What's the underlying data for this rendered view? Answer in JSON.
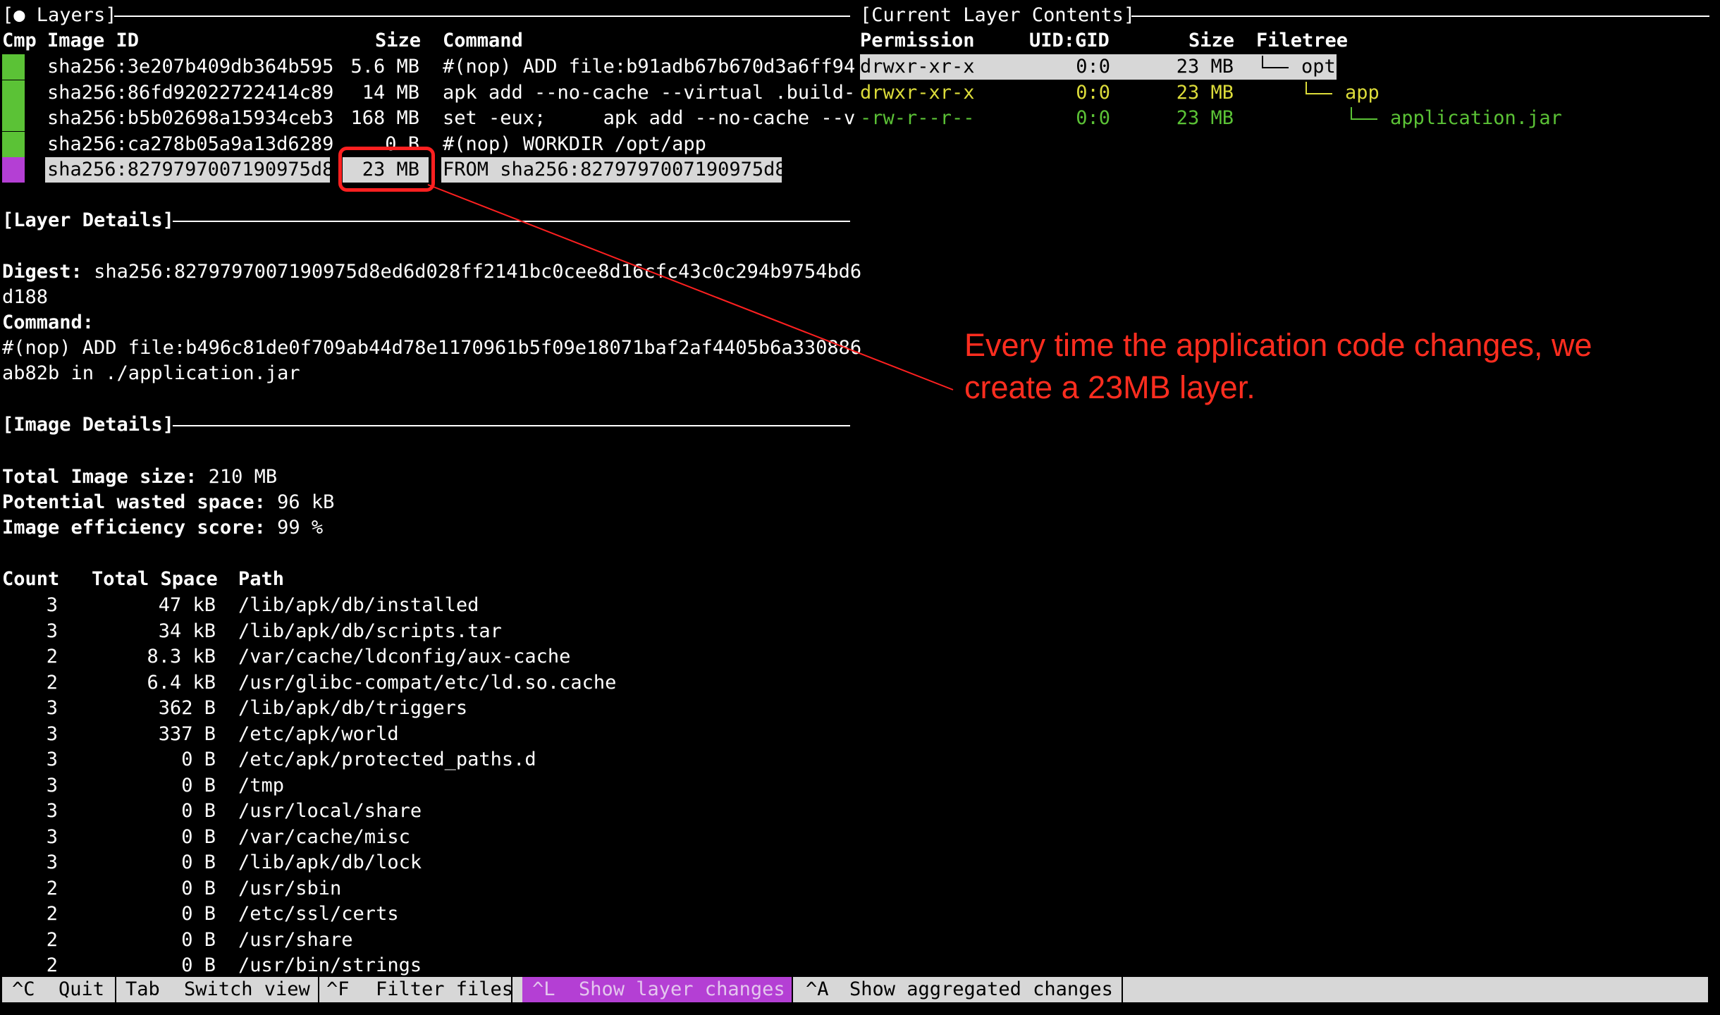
{
  "layers": {
    "title": "[● Layers]",
    "col_cmp": "Cmp",
    "col_image": "Image ID",
    "col_size": "Size",
    "col_command": "Command",
    "rows": [
      {
        "id": "sha256:3e207b409db364b595",
        "size": "5.6 MB",
        "command": "#(nop) ADD file:b91adb67b670d3a6ff94",
        "color": "#5bc236"
      },
      {
        "id": "sha256:86fd92022722414c89",
        "size": "14 MB",
        "command": "apk add --no-cache --virtual .build-",
        "color": "#5bc236"
      },
      {
        "id": "sha256:b5b02698a15934ceb3",
        "size": "168 MB",
        "command": "set -eux;     apk add --no-cache --v",
        "color": "#5bc236"
      },
      {
        "id": "sha256:ca278b05a9a13d6289",
        "size": "0 B",
        "command": "#(nop) WORKDIR /opt/app",
        "color": "#5bc236"
      },
      {
        "id": "sha256:8279797007190975d8",
        "size": "23 MB",
        "command": "FROM sha256:8279797007190975d8",
        "color": "#b43fd4"
      }
    ]
  },
  "layer_details": {
    "title": "[Layer Details]",
    "digest_label": "Digest:",
    "digest_value": "sha256:8279797007190975d8ed6d028ff2141bc0cee8d16cfc43c0c294b9754bd6",
    "digest_value_2": "d188",
    "command_label": "Command:",
    "command_line1": "#(nop) ADD file:b496c81de0f709ab44d78e1170961b5f09e18071baf2af4405b6a330886",
    "command_line2": "ab82b in ./application.jar"
  },
  "image_details": {
    "title": "[Image Details]",
    "total_label": "Total Image size:",
    "total_value": "210 MB",
    "wasted_label": "Potential wasted space:",
    "wasted_value": "96 kB",
    "efficiency_label": "Image efficiency score:",
    "efficiency_value": "99 %",
    "col_count": "Count",
    "col_total": "Total Space",
    "col_path": "Path",
    "rows": [
      {
        "count": "3",
        "space": "47 kB",
        "path": "/lib/apk/db/installed"
      },
      {
        "count": "3",
        "space": "34 kB",
        "path": "/lib/apk/db/scripts.tar"
      },
      {
        "count": "2",
        "space": "8.3 kB",
        "path": "/var/cache/ldconfig/aux-cache"
      },
      {
        "count": "2",
        "space": "6.4 kB",
        "path": "/usr/glibc-compat/etc/ld.so.cache"
      },
      {
        "count": "3",
        "space": "362 B",
        "path": "/lib/apk/db/triggers"
      },
      {
        "count": "3",
        "space": "337 B",
        "path": "/etc/apk/world"
      },
      {
        "count": "3",
        "space": "0 B",
        "path": "/etc/apk/protected_paths.d"
      },
      {
        "count": "3",
        "space": "0 B",
        "path": "/tmp"
      },
      {
        "count": "3",
        "space": "0 B",
        "path": "/usr/local/share"
      },
      {
        "count": "3",
        "space": "0 B",
        "path": "/var/cache/misc"
      },
      {
        "count": "3",
        "space": "0 B",
        "path": "/lib/apk/db/lock"
      },
      {
        "count": "2",
        "space": "0 B",
        "path": "/usr/sbin"
      },
      {
        "count": "2",
        "space": "0 B",
        "path": "/etc/ssl/certs"
      },
      {
        "count": "2",
        "space": "0 B",
        "path": "/usr/share"
      },
      {
        "count": "2",
        "space": "0 B",
        "path": "/usr/bin/strings"
      }
    ]
  },
  "contents": {
    "title": "[Current Layer Contents]",
    "col_perm": "Permission",
    "col_uid": "UID:GID",
    "col_size": "Size",
    "col_tree": "Filetree",
    "rows": [
      {
        "perm": "drwxr-xr-x",
        "uid": "0:0",
        "size": "23 MB",
        "name": "opt"
      },
      {
        "perm": "drwxr-xr-x",
        "uid": "0:0",
        "size": "23 MB",
        "name": "app"
      },
      {
        "perm": "-rw-r--r--",
        "uid": "0:0",
        "size": "23 MB",
        "name": "application.jar"
      }
    ]
  },
  "footer": {
    "items": [
      {
        "key": "^C",
        "label": "Quit"
      },
      {
        "key": "Tab",
        "label": "Switch view"
      },
      {
        "key": "^F",
        "label": "Filter files"
      },
      {
        "key": "^L",
        "label": "Show layer changes"
      },
      {
        "key": "^A",
        "label": "Show aggregated changes"
      }
    ],
    "active_color": "#b43fd4"
  },
  "annotation": {
    "line1": "Every time the application code changes, we",
    "line2": "create a 23MB layer.",
    "color": "#ff2d1f"
  }
}
